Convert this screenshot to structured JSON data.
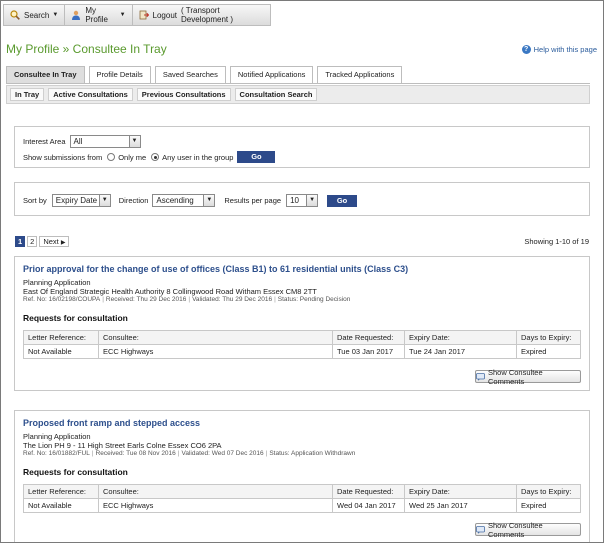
{
  "toolbar": {
    "search_label": "Search",
    "profile_label": "My Profile",
    "logout_label": "Logout",
    "logout_user": "( Transport Development )"
  },
  "page": {
    "title": "My Profile » Consultee In Tray",
    "help_label": "Help with this page"
  },
  "tabs": [
    {
      "label": "Consultee In Tray",
      "active": true
    },
    {
      "label": "Profile Details"
    },
    {
      "label": "Saved Searches"
    },
    {
      "label": "Notified Applications"
    },
    {
      "label": "Tracked Applications"
    }
  ],
  "subtabs": [
    {
      "label": "In Tray"
    },
    {
      "label": "Active Consultations"
    },
    {
      "label": "Previous Consultations"
    },
    {
      "label": "Consultation Search"
    }
  ],
  "filter": {
    "interest_area_label": "Interest Area",
    "interest_area_value": "All",
    "show_from_label": "Show submissions from",
    "only_me_label": "Only me",
    "any_user_label": "Any user in the group",
    "go_label": "Go"
  },
  "sort": {
    "sort_by_label": "Sort by",
    "sort_by_value": "Expiry Date",
    "direction_label": "Direction",
    "direction_value": "Ascending",
    "per_page_label": "Results per page",
    "per_page_value": "10",
    "go_label": "Go"
  },
  "pager": {
    "page1": "1",
    "page2": "2",
    "next_label": "Next",
    "showing": "Showing 1-10 of 19"
  },
  "table_headers": [
    "Letter Reference:",
    "Consultee:",
    "Date Requested:",
    "Expiry Date:",
    "Days to Expiry:"
  ],
  "requests_heading": "Requests for consultation",
  "show_comments_label": "Show Consultee Comments",
  "results": [
    {
      "title": "Prior approval for the change of use of offices (Class B1) to 61 residential units (Class C3)",
      "type": "Planning Application",
      "address": "East Of England Strategic Health Authority 8 Collingwood Road Witham Essex CM8 2TT",
      "ref": "Ref. No: 16/02198/COUPA",
      "received": "Received: Thu 29 Dec 2016",
      "validated": "Validated: Thu 29 Dec 2016",
      "status": "Status: Pending Decision",
      "row": [
        "Not Available",
        "ECC Highways",
        "Tue 03 Jan 2017",
        "Tue 24 Jan 2017",
        "Expired"
      ]
    },
    {
      "title": "Proposed front ramp and stepped access",
      "type": "Planning Application",
      "address": "The Lion PH 9 - 11 High Street Earls Colne Essex CO6 2PA",
      "ref": "Ref. No: 16/01882/FUL",
      "received": "Received: Tue 08 Nov 2016",
      "validated": "Validated: Wed 07 Dec 2016",
      "status": "Status: Application Withdrawn",
      "row": [
        "Not Available",
        "ECC Highways",
        "Wed 04 Jan 2017",
        "Wed 25 Jan 2017",
        "Expired"
      ]
    }
  ]
}
